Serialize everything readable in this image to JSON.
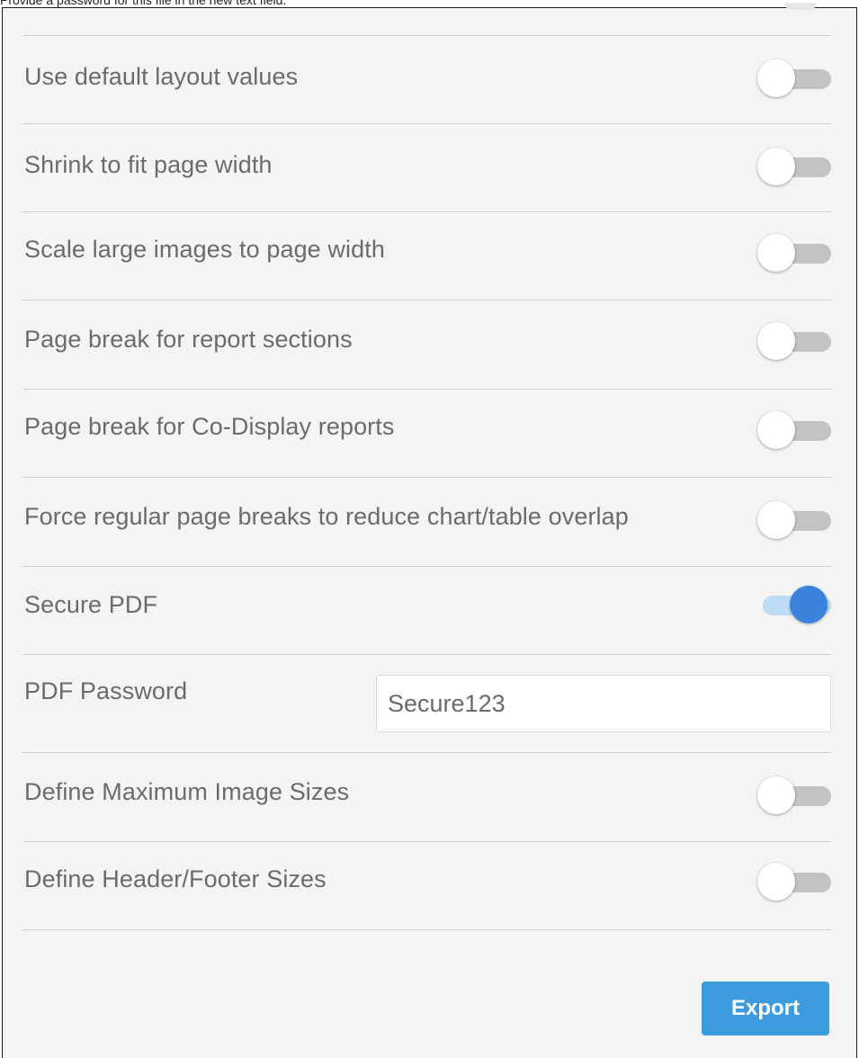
{
  "instruction_caption": "Provide a password for this file in the new text field.",
  "options": [
    {
      "label": "Use default layout values",
      "on": false
    },
    {
      "label": "Shrink to fit page width",
      "on": false
    },
    {
      "label": "Scale large images to page width",
      "on": false
    },
    {
      "label": "Page break for report sections",
      "on": false
    },
    {
      "label": "Page break for Co-Display reports",
      "on": false
    },
    {
      "label": "Force regular page breaks to reduce chart/table overlap",
      "on": false
    },
    {
      "label": "Secure PDF",
      "on": true
    }
  ],
  "password": {
    "label": "PDF Password",
    "value": "Secure123"
  },
  "options_after": [
    {
      "label": "Define Maximum Image Sizes",
      "on": false
    },
    {
      "label": "Define Header/Footer Sizes",
      "on": false
    }
  ],
  "export_button_label": "Export",
  "colors": {
    "toggle_on_knob": "#3a82dc",
    "toggle_on_track": "#bcdcf5",
    "toggle_off_track": "#c3c3c3",
    "export_button": "#3d9be0",
    "panel_background": "#f4f4f4"
  }
}
